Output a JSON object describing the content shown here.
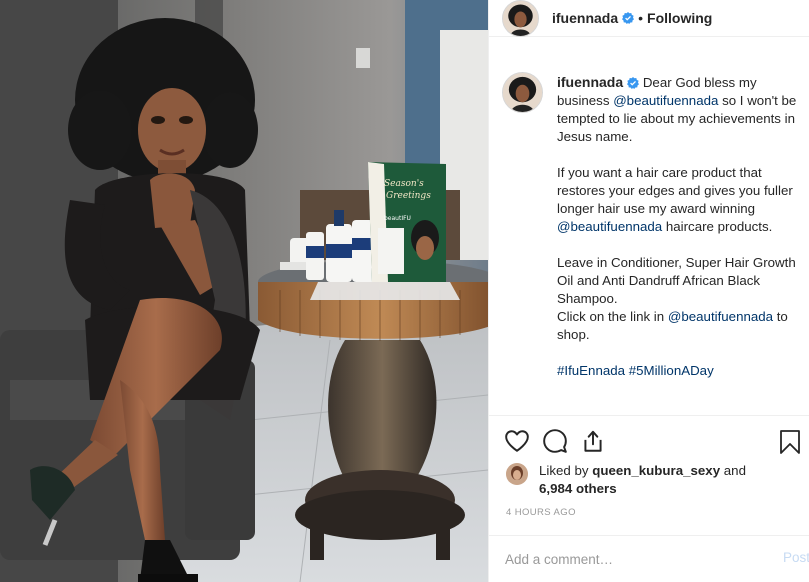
{
  "post": {
    "username": "ifuennada",
    "follow_separator": "•",
    "follow_state": "Following"
  },
  "caption": {
    "username": "ifuennada",
    "p1_a": " Dear God bless my business ",
    "p1_mention": "@beautifuennada",
    "p1_b": " so I won't be tempted to lie about my achievements in Jesus name.",
    "p2_a": "If you want a hair care product that restores your edges and gives you fuller longer hair use my award winning ",
    "p2_mention": "@beautifuennada",
    "p2_b": " haircare products.",
    "p3": "Leave in Conditioner, Super Hair Growth Oil and Anti Dandruff African Black Shampoo.",
    "p4_a": "Click on the link in ",
    "p4_mention": "@beautifuennada",
    "p4_b": " to shop.",
    "hashtag1": "#IfuEnnada",
    "hashtag2": "#5MillionADay"
  },
  "likes": {
    "prefix": "Liked by ",
    "user": "queen_kubura_sexy",
    "and": " and",
    "count": "6,984 others"
  },
  "timestamp": "4 HOURS AGO",
  "comment_box": {
    "placeholder": "Add a comment…",
    "post_label": "Post"
  },
  "product_card": {
    "line1": "Season's",
    "line2": "Greetings",
    "brand": "beautIFU"
  },
  "icons": {
    "like": "heart-icon",
    "comment": "comment-icon",
    "share": "share-icon",
    "save": "bookmark-icon",
    "verified": "verified-badge-icon"
  },
  "colors": {
    "link": "#003569",
    "muted": "#999999",
    "post_disabled": "#c7dbf3",
    "verified": "#3897f0"
  }
}
